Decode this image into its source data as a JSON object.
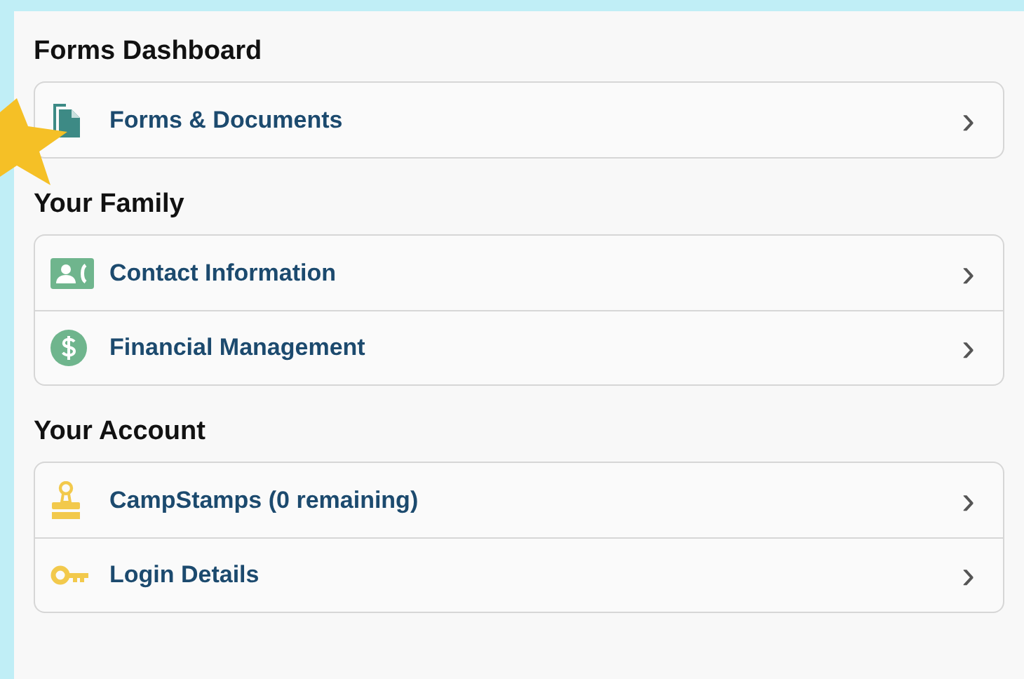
{
  "sections": [
    {
      "title": "Forms Dashboard",
      "items": [
        {
          "label": "Forms & Documents",
          "chevron": "›"
        }
      ]
    },
    {
      "title": "Your Family",
      "items": [
        {
          "label": "Contact Information",
          "chevron": "›"
        },
        {
          "label": "Financial Management",
          "chevron": "›"
        }
      ]
    },
    {
      "title": "Your Account",
      "items": [
        {
          "label": "CampStamps (0 remaining)",
          "chevron": "›"
        },
        {
          "label": "Login Details",
          "chevron": "›"
        }
      ]
    }
  ]
}
